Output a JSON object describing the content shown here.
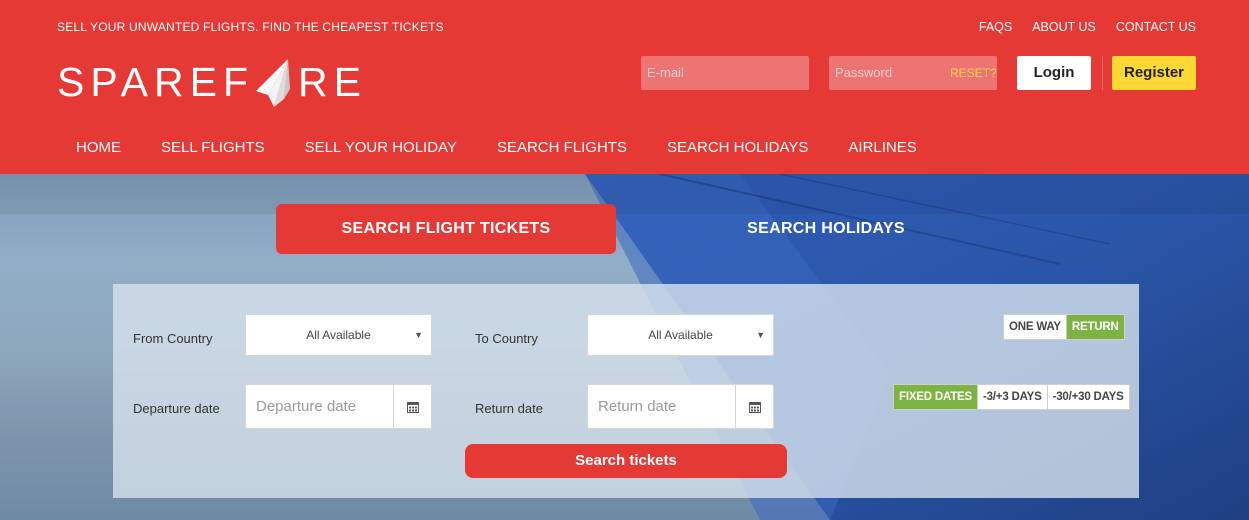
{
  "header": {
    "tagline": "SELL YOUR UNWANTED FLIGHTS. FIND THE CHEAPEST TICKETS",
    "top_links": [
      "FAQS",
      "ABOUT US",
      "CONTACT US"
    ],
    "logo_left": "SPAREF",
    "logo_right": "RE",
    "email_placeholder": "E-mail",
    "password_placeholder": "Password",
    "reset_label": "RESET?",
    "login_label": "Login",
    "register_label": "Register"
  },
  "nav": [
    "HOME",
    "SELL FLIGHTS",
    "SELL YOUR HOLIDAY",
    "SEARCH FLIGHTS",
    "SEARCH HOLIDAYS",
    "AIRLINES"
  ],
  "search": {
    "tabs": [
      "SEARCH FLIGHT TICKETS",
      "SEARCH HOLIDAYS"
    ],
    "from_label": "From Country",
    "from_value": "All Available",
    "to_label": "To Country",
    "to_value": "All Available",
    "departure_label": "Departure date",
    "departure_placeholder": "Departure date",
    "return_label": "Return date",
    "return_placeholder": "Return date",
    "trip_options": [
      "ONE WAY",
      "RETURN"
    ],
    "trip_selected": "RETURN",
    "date_options": [
      "FIXED DATES",
      "-3/+3 DAYS",
      "-30/+30 DAYS"
    ],
    "date_selected": "FIXED DATES",
    "submit_label": "Search tickets"
  },
  "colors": {
    "brand_red": "#e53935",
    "register_yellow": "#fdd835",
    "selected_green": "#7cb342",
    "reset_yellow": "#ffd54f"
  },
  "icons": [
    "paper-plane-logo-icon",
    "calendar-icon",
    "caret-down-icon"
  ]
}
